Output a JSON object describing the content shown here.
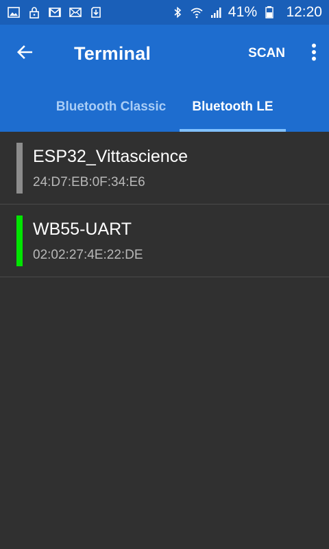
{
  "status_bar": {
    "battery_percent": "41%",
    "time": "12:20",
    "icons_left": [
      "image-icon",
      "lock-icon",
      "gmail-icon",
      "mail-icon",
      "download-icon"
    ],
    "icons_right": [
      "bluetooth-icon",
      "wifi-icon",
      "signal-icon",
      "battery-icon"
    ]
  },
  "app_bar": {
    "title": "Terminal",
    "scan_label": "SCAN"
  },
  "tabs": [
    {
      "label": "Bluetooth Classic",
      "selected": false
    },
    {
      "label": "Bluetooth LE",
      "selected": true
    }
  ],
  "devices": [
    {
      "name": "ESP32_Vittascience",
      "address": "24:D7:EB:0F:34:E6",
      "indicator_color": "#8c8c8c"
    },
    {
      "name": "WB55-UART",
      "address": "02:02:27:4E:22:DE",
      "indicator_color": "#00e400"
    }
  ],
  "colors": {
    "status_bar": "#1a5fb8",
    "primary": "#1e6dcf",
    "tab_indicator": "#80c0ff",
    "background": "#303030"
  }
}
